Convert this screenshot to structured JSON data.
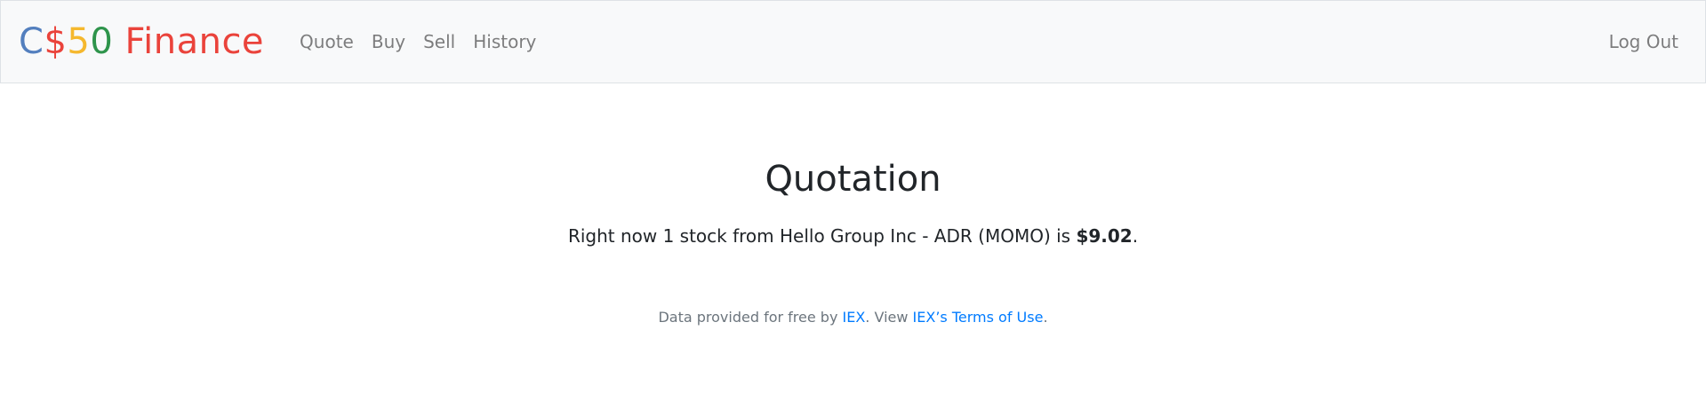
{
  "navbar": {
    "brand": {
      "parts": [
        {
          "text": "C",
          "color": "#537fbe"
        },
        {
          "text": "$",
          "color": "#ea433b"
        },
        {
          "text": "5",
          "color": "#f5b82e"
        },
        {
          "text": "0",
          "color": "#2e944b"
        },
        {
          "text": " Finance",
          "color": "#ea433b"
        }
      ]
    },
    "links": [
      "Quote",
      "Buy",
      "Sell",
      "History"
    ],
    "logout": "Log Out"
  },
  "main": {
    "heading": "Quotation",
    "quote_prefix": "Right now 1 stock from Hello Group Inc - ADR (MOMO) is ",
    "price": "$9.02",
    "quote_suffix": "."
  },
  "footer": {
    "prefix": "Data provided for free by ",
    "iex_link": "IEX",
    "middle": ". View ",
    "terms_link": "IEX’s Terms of Use",
    "suffix": "."
  }
}
